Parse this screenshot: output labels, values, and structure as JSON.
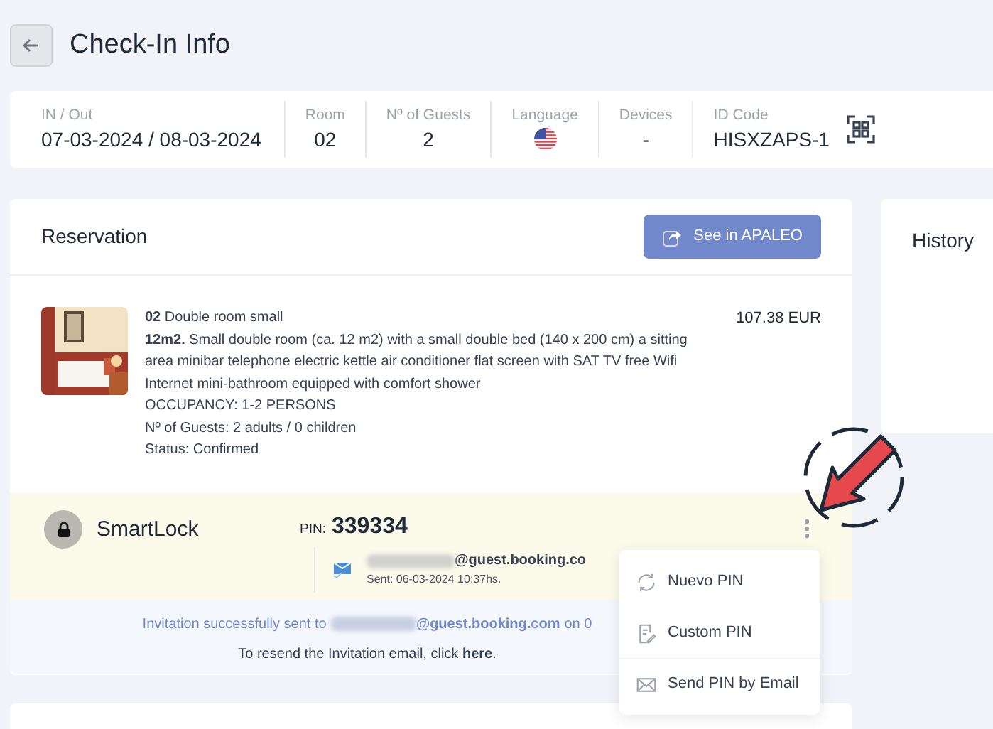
{
  "header": {
    "title": "Check-In Info"
  },
  "info": [
    {
      "label": "IN / Out",
      "value": "07-03-2024 / 08-03-2024",
      "kind": "text"
    },
    {
      "label": "Room",
      "value": "02",
      "kind": "text"
    },
    {
      "label": "Nº of Guests",
      "value": "2",
      "kind": "text"
    },
    {
      "label": "Language",
      "kind": "flag"
    },
    {
      "label": "Devices",
      "value": "-",
      "kind": "text"
    },
    {
      "label": "ID Code",
      "value": "HISXZAPS-1",
      "kind": "qr"
    }
  ],
  "reservation": {
    "title": "Reservation",
    "button": "See in APALEO",
    "price": "107.38 EUR",
    "lines": [
      "**02** Double room small",
      "**12m2.** Small double room (ca. 12 m2) with a small double bed (140 x 200 cm) a sitting area minibar telephone electric kettle air conditioner flat screen with SAT TV free Wifi Internet mini-bathroom equipped with comfort shower",
      "OCCUPANCY: 1-2 PERSONS",
      "Nº of Guests: 2 adults / 0 children",
      "Status: Confirmed"
    ]
  },
  "smartlock": {
    "title": "SmartLock",
    "pin_label": "PIN:",
    "pin": "339334",
    "email": "@guest.booking.co",
    "sent": "Sent: 06-03-2024 10:37hs."
  },
  "invitation": {
    "prefix": "Invitation successfully sent to",
    "email": "@guest.booking.com",
    "suffix": "on 0",
    "resend": "To resend the Invitation email, click **here**."
  },
  "menu": [
    {
      "label": "Nuevo PIN",
      "kind": "refresh",
      "separated": false
    },
    {
      "label": "Custom PIN",
      "kind": "edit",
      "separated": false
    },
    {
      "label": "Send PIN by Email",
      "kind": "mail",
      "separated": true
    }
  ],
  "history": {
    "title": "History"
  }
}
